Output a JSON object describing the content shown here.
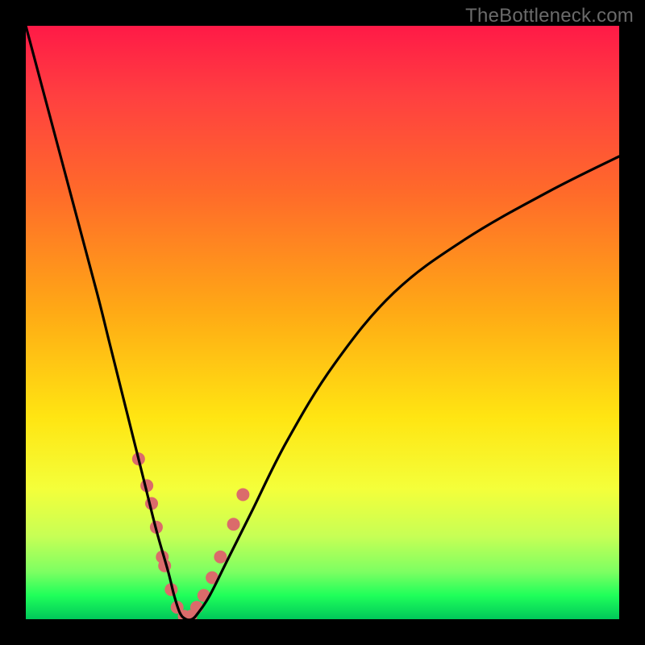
{
  "watermark": "TheBottleneck.com",
  "chart_data": {
    "type": "line",
    "title": "",
    "xlabel": "",
    "ylabel": "",
    "xlim": [
      0,
      100
    ],
    "ylim": [
      0,
      100
    ],
    "series": [
      {
        "name": "bottleneck-curve",
        "x": [
          0,
          4,
          8,
          12,
          14,
          16,
          18,
          20,
          22,
          24,
          25,
          26,
          27,
          28,
          29,
          31,
          34,
          38,
          44,
          52,
          62,
          74,
          88,
          100
        ],
        "y": [
          100,
          85,
          70,
          55,
          47,
          39,
          31,
          23,
          15,
          8,
          4,
          1,
          0,
          0,
          1,
          4,
          10,
          18,
          30,
          43,
          55,
          64,
          72,
          78
        ]
      }
    ],
    "markers": {
      "name": "highlight-points",
      "x": [
        19.0,
        20.4,
        21.2,
        22.0,
        23.0,
        23.4,
        24.5,
        25.5,
        26.7,
        27.8,
        28.8,
        30.0,
        31.4,
        32.8,
        35.0,
        36.6
      ],
      "y": [
        27.0,
        22.5,
        19.5,
        15.5,
        10.5,
        9.0,
        5.0,
        2.0,
        0.5,
        0.5,
        2.0,
        4.0,
        7.0,
        10.5,
        16.0,
        21.0
      ],
      "color": "#db6b6b",
      "radius": 8
    },
    "curve_color": "#000000"
  }
}
